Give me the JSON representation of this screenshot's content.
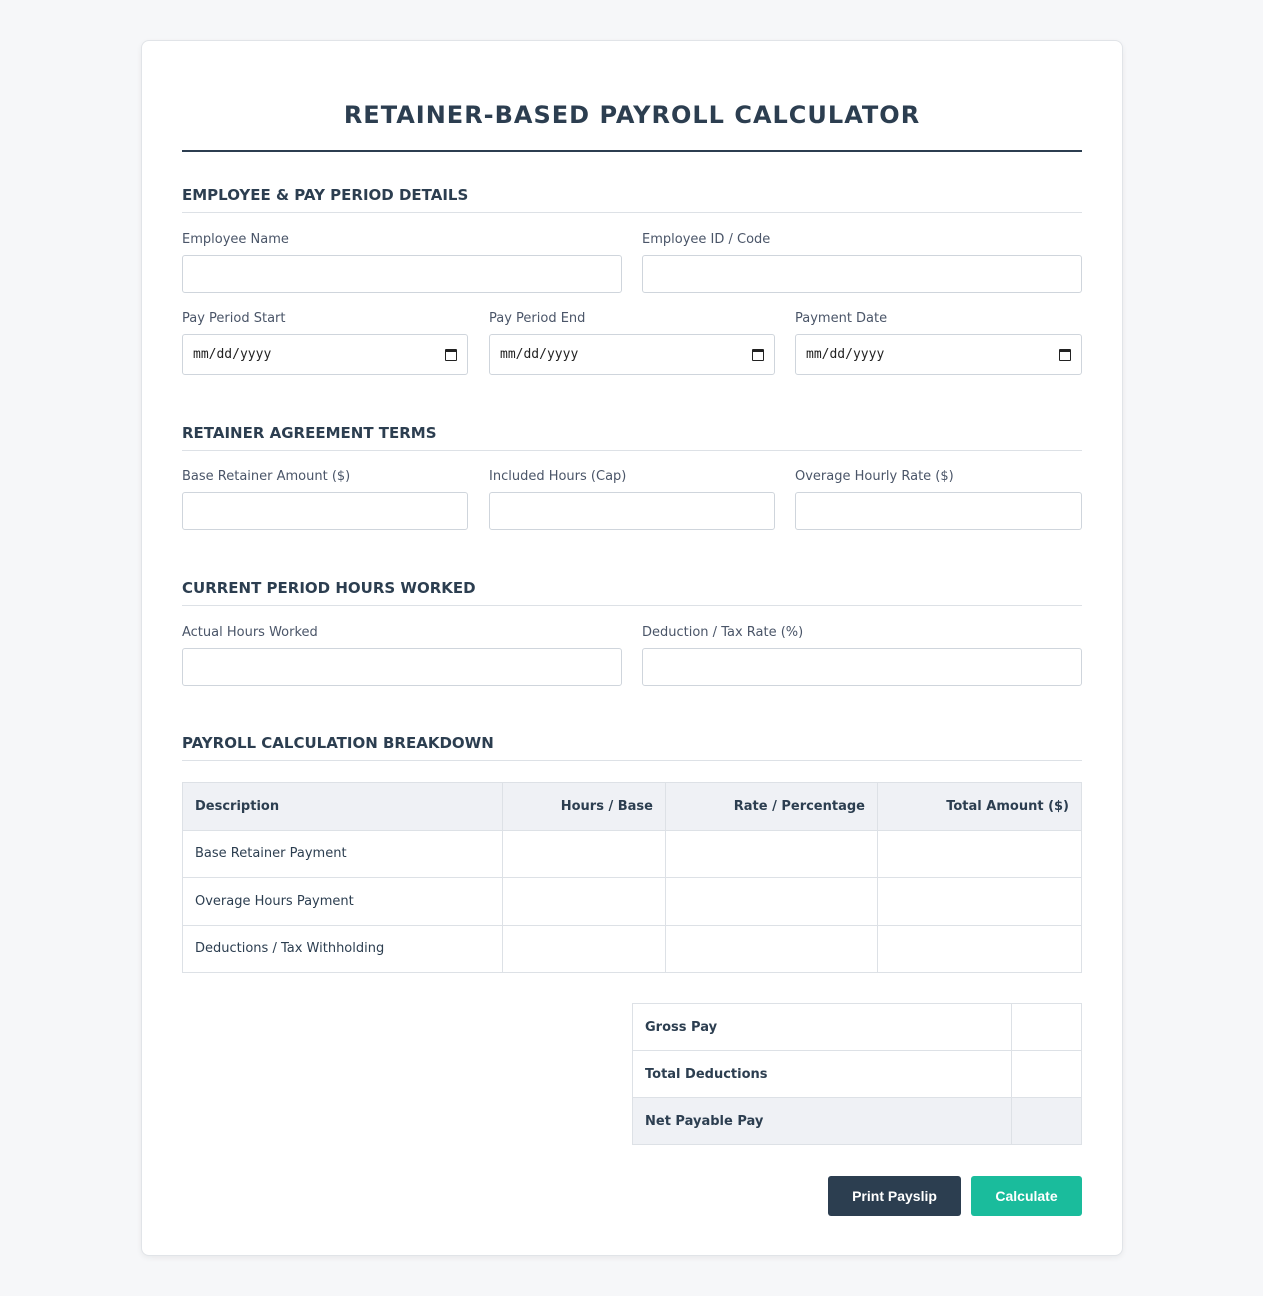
{
  "title": "RETAINER-BASED PAYROLL CALCULATOR",
  "sections": {
    "employee": {
      "title": "EMPLOYEE & PAY PERIOD DETAILS",
      "employee_name_label": "Employee Name",
      "employee_name_value": "",
      "employee_id_label": "Employee ID / Code",
      "employee_id_value": "",
      "pay_period_start_label": "Pay Period Start",
      "pay_period_start_value": "mm/dd/yyyy",
      "pay_period_end_label": "Pay Period End",
      "pay_period_end_value": "mm/dd/yyyy",
      "payment_date_label": "Payment Date",
      "payment_date_value": "mm/dd/yyyy"
    },
    "retainer": {
      "title": "RETAINER AGREEMENT TERMS",
      "base_amount_label": "Base Retainer Amount ($)",
      "included_hours_label": "Included Hours (Cap)",
      "overage_rate_label": "Overage Hourly Rate ($)"
    },
    "hours": {
      "title": "CURRENT PERIOD HOURS WORKED",
      "actual_hours_label": "Actual Hours Worked",
      "deduction_rate_label": "Deduction / Tax Rate (%)"
    },
    "breakdown": {
      "title": "PAYROLL CALCULATION BREAKDOWN",
      "headers": [
        "Description",
        "Hours / Base",
        "Rate / Percentage",
        "Total Amount ($)"
      ],
      "rows": [
        {
          "description": "Base Retainer Payment",
          "hours": "",
          "rate": "",
          "total": ""
        },
        {
          "description": "Overage Hours Payment",
          "hours": "",
          "rate": "",
          "total": ""
        },
        {
          "description": "Deductions / Tax Withholding",
          "hours": "",
          "rate": "",
          "total": ""
        }
      ]
    },
    "summary": {
      "gross_label": "Gross Pay",
      "gross_value": "",
      "deductions_label": "Total Deductions",
      "deductions_value": "",
      "net_label": "Net Payable Pay",
      "net_value": ""
    }
  },
  "buttons": {
    "print_label": "Print Payslip",
    "calculate_label": "Calculate"
  },
  "colors": {
    "primary": "#2c3e50",
    "accent": "#1abc9c",
    "background": "#f6f7f9"
  }
}
